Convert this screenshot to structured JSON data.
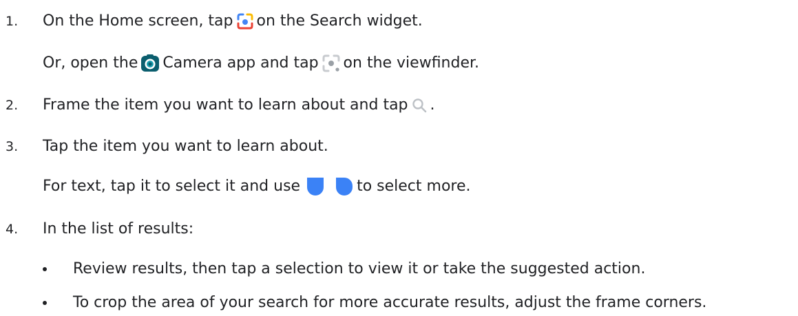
{
  "steps": [
    {
      "number": "1.",
      "before_icon": "On the Home screen, tap",
      "icon": "google-lens-widget-icon",
      "after_icon": "on the Search widget.",
      "sub": {
        "before_icon": "Or, open the",
        "icon": "camera-app-icon",
        "middle": "Camera app and tap",
        "icon2": "lens-viewfinder-icon",
        "after_icon": "on the viewfinder."
      }
    },
    {
      "number": "2.",
      "before_icon": "Frame the item you want to learn about and tap",
      "icon": "search-icon",
      "after_icon": "."
    },
    {
      "number": "3.",
      "text": "Tap the item you want to learn about.",
      "sub": {
        "before_icon": "For text, tap it to select it and use",
        "icon": "selection-handle-left-icon",
        "icon2": "selection-handle-right-icon",
        "after_icon": "to select more."
      }
    },
    {
      "number": "4.",
      "text": "In the list of results:",
      "bullets": [
        "Review results, then tap a selection to view it or take the suggested action.",
        "To crop the area of your search for more accurate results, adjust the frame corners."
      ]
    }
  ],
  "colors": {
    "text": "#202124",
    "google_blue": "#4285F4",
    "google_red": "#EA4335",
    "google_yellow": "#FBBC04",
    "google_green": "#34A853",
    "camera_teal": "#0B5E6E",
    "icon_gray": "#9AA0A6",
    "handle_blue": "#3B82F6"
  }
}
